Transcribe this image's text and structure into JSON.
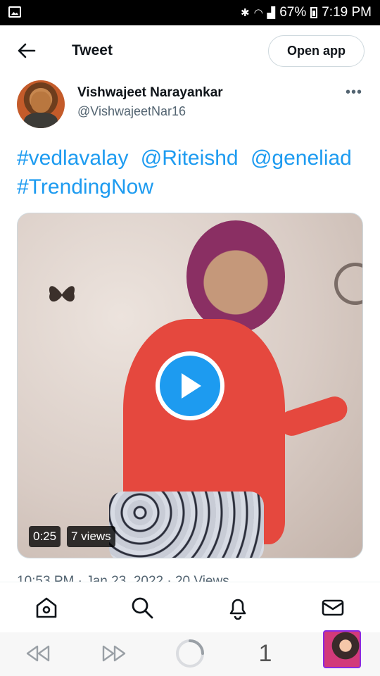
{
  "status_bar": {
    "battery": "67%",
    "time": "7:19 PM"
  },
  "header": {
    "title": "Tweet",
    "open_app_label": "Open app"
  },
  "tweet": {
    "author_name": "Vishwajeet Narayankar",
    "author_handle": "@VishwajeetNar16",
    "more_label": "•••",
    "text_parts": [
      "#vedlavalay",
      "@Riteishd",
      "@geneliad",
      "#TrendingNow"
    ],
    "video": {
      "duration": "0:25",
      "views": "7 views"
    },
    "timestamp_partial": "10:53 PM · Jan 23, 2022 · 20 Views"
  },
  "bottom_nav": {
    "items": [
      "home-icon",
      "search-icon",
      "notifications-icon",
      "messages-icon"
    ]
  },
  "android_bar": {
    "tab_count": "1"
  },
  "colors": {
    "accent": "#1d9bf0",
    "text": "#0f1419",
    "secondary": "#536471"
  }
}
